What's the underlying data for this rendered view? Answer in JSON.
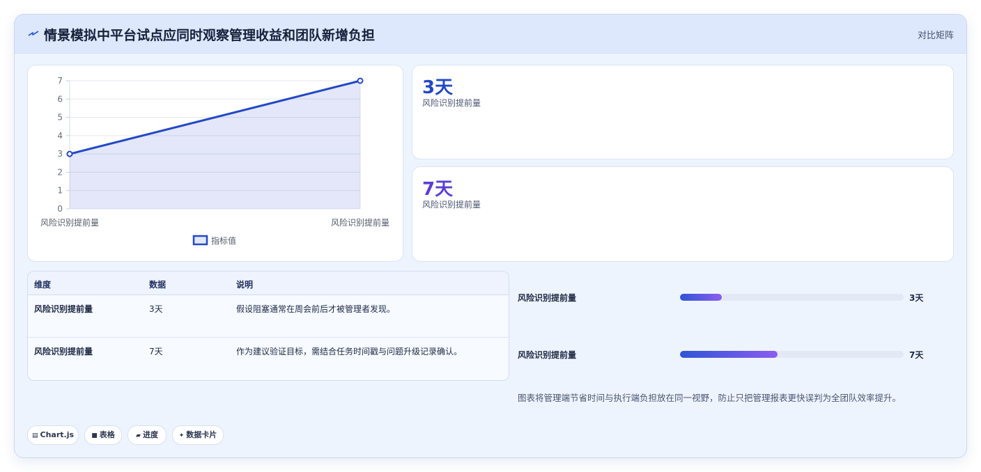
{
  "header": {
    "title": "情景模拟中平台试点应同时观察管理收益和团队新增负担",
    "logo_icon": "lightning-icon",
    "toggle_label": "对比矩阵"
  },
  "chart_data": {
    "type": "line",
    "categories": [
      "风险识别提前量",
      "风险识别提前量"
    ],
    "series": [
      {
        "name": "指标值",
        "values": [
          3,
          7
        ],
        "color": "#2348c5",
        "fill": "rgba(99,120,220,0.18)"
      }
    ],
    "ylim": [
      0,
      7
    ],
    "yticks": [
      0,
      1,
      2,
      3,
      4,
      5,
      6,
      7
    ],
    "grid": true,
    "legend": "bottom"
  },
  "stats": [
    {
      "value": "3天",
      "label": "风险识别提前量",
      "color": "#2348c5"
    },
    {
      "value": "7天",
      "label": "风险识别提前量",
      "color": "#5a3fd6"
    }
  ],
  "table": {
    "headers": [
      "维度",
      "数据",
      "说明"
    ],
    "rows": [
      [
        "风险识别提前量",
        "3天",
        "假设阻塞通常在周会前后才被管理者发现。"
      ],
      [
        "风险识别提前量",
        "7天",
        "作为建议验证目标，需结合任务时间戳与问题升级记录确认。"
      ]
    ]
  },
  "progress": [
    {
      "label": "风险识别提前量",
      "value_text": "3天",
      "value": 3,
      "max": 16
    },
    {
      "label": "风险识别提前量",
      "value_text": "7天",
      "value": 7,
      "max": 16
    }
  ],
  "note": "图表将管理端节省时间与执行端负担放在同一视野，防止只把管理报表更快误判为全团队效率提升。",
  "tags": [
    {
      "icon": "chart-icon",
      "glyph": "▤",
      "label": "Chart.js"
    },
    {
      "icon": "table-icon",
      "glyph": "■",
      "label": "表格"
    },
    {
      "icon": "progress-icon",
      "glyph": "▰",
      "label": "进度"
    },
    {
      "icon": "sparkle-icon",
      "glyph": "✦",
      "label": "数据卡片"
    }
  ]
}
